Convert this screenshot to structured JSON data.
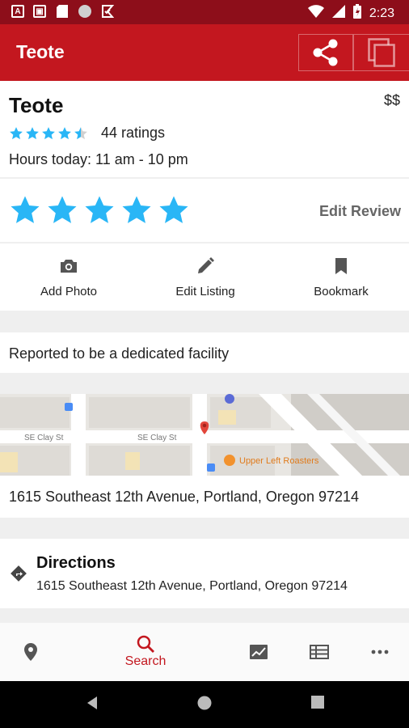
{
  "status_bar": {
    "time": "2:23",
    "left_icons": [
      "a-box-icon",
      "image-box-icon",
      "sd-card-icon",
      "circle-icon",
      "download-check-icon"
    ],
    "right_icons": [
      "wifi-icon",
      "signal-icon",
      "battery-icon"
    ]
  },
  "app_bar": {
    "title": "Teote",
    "actions": [
      "share-icon",
      "copy-icon"
    ]
  },
  "place": {
    "name": "Teote",
    "price": "$$",
    "rating": 4.5,
    "ratings_count": "44 ratings",
    "hours": "Hours today: 11 am - 10 pm"
  },
  "review": {
    "user_rating": 5,
    "edit_label": "Edit Review"
  },
  "actions": [
    {
      "label": "Add Photo",
      "icon": "camera-icon"
    },
    {
      "label": "Edit Listing",
      "icon": "pencil-icon"
    },
    {
      "label": "Bookmark",
      "icon": "bookmark-icon"
    }
  ],
  "note": "Reported to be a dedicated facility",
  "map": {
    "street_labels": [
      "SE Clay St",
      "SE Clay St"
    ],
    "poi_label": "Upper Left Roasters"
  },
  "address": "1615 Southeast 12th Avenue, Portland, Oregon 97214",
  "directions": {
    "title": "Directions",
    "address": "1615 Southeast 12th Avenue, Portland, Oregon 97214"
  },
  "bottom_nav": {
    "items": [
      {
        "icon": "location-pin-icon",
        "label": ""
      },
      {
        "icon": "search-icon",
        "label": "Search"
      },
      {
        "icon": "trending-chart-icon",
        "label": ""
      },
      {
        "icon": "table-list-icon",
        "label": ""
      },
      {
        "icon": "more-dots-icon",
        "label": ""
      }
    ],
    "active": 1
  },
  "colors": {
    "primary": "#c3171f",
    "status_bar": "#8d0e1a",
    "star": "#29b6f6"
  }
}
